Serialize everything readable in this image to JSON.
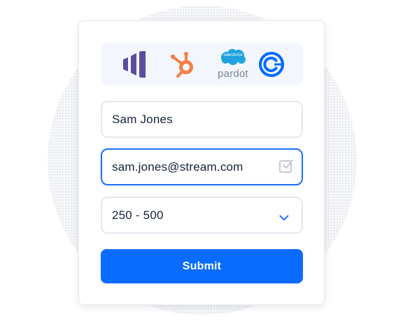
{
  "brand_colors": {
    "accent": "#0a6cff",
    "marketo": "#5c4c9f",
    "hubspot": "#f57f47",
    "salesforce": "#1ea2e0",
    "calendly": "#006bff"
  },
  "integrations": [
    {
      "name": "Marketo",
      "icon": "marketo-logo-icon"
    },
    {
      "name": "HubSpot",
      "icon": "hubspot-logo-icon"
    },
    {
      "name": "Salesforce Pardot",
      "icon": "salesforce-pardot-logo-icon",
      "badge": "salesforce",
      "label": "pardot"
    },
    {
      "name": "Calendly",
      "icon": "calendly-logo-icon"
    }
  ],
  "form": {
    "name_value": "Sam Jones",
    "email_value": "sam.jones@stream.com",
    "company_size_value": "250 - 500",
    "submit_label": "Submit"
  }
}
